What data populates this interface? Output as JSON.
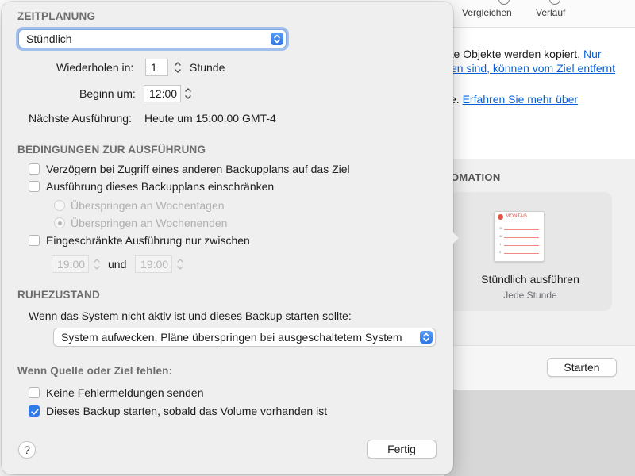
{
  "background": {
    "tabs": [
      "Vergleichen",
      "Verlauf"
    ],
    "lines": [
      {
        "text": "rte Objekte werden kopiert. ",
        "link": "Nur"
      },
      {
        "text": "",
        "link": "en sind, können vom Ziel entfernt"
      },
      {
        "text": "e. ",
        "link": "Erfahren Sie mehr über"
      }
    ],
    "section_title": "OMATION",
    "calendar_day": "MONTAG",
    "card_title": "Stündlich ausführen",
    "card_subtitle": "Jede Stunde",
    "start_button": "Starten"
  },
  "schedule": {
    "title": "ZEITPLANUNG",
    "frequency": "Stündlich",
    "repeat_label": "Wiederholen in:",
    "repeat_value": "1",
    "repeat_unit": "Stunde",
    "start_label": "Beginn um:",
    "start_value": "12:00",
    "next_label": "Nächste Ausführung:",
    "next_value": "Heute um 15:00:00 GMT-4"
  },
  "conditions": {
    "title": "BEDINGUNGEN ZUR AUSFÜHRUNG",
    "delay_label": "Verzögern bei Zugriff eines anderen Backupplans auf das Ziel",
    "delay_checked": false,
    "restrict_label": "Ausführung dieses Backupplans einschränken",
    "restrict_checked": false,
    "skip_weekdays": "Überspringen an Wochentagen",
    "skip_weekends": "Überspringen an Wochenenden",
    "limited_label": "Eingeschränkte Ausführung nur zwischen",
    "limited_checked": false,
    "from_time": "19:00",
    "and_label": "und",
    "to_time": "19:00"
  },
  "sleep": {
    "title": "RUHEZUSTAND",
    "question": "Wenn das System nicht aktiv ist und dieses Backup starten sollte:",
    "option": "System aufwecken, Pläne überspringen bei ausgeschaltetem System"
  },
  "missing": {
    "title": "Wenn Quelle oder Ziel fehlen:",
    "no_errors_label": "Keine Fehlermeldungen senden",
    "no_errors_checked": false,
    "start_on_volume_label": "Dieses Backup starten, sobald das Volume vorhanden ist",
    "start_on_volume_checked": true
  },
  "footer": {
    "help": "?",
    "done": "Fertig"
  },
  "colors": {
    "accent": "#2f7be8",
    "link": "#0a5fd7"
  }
}
